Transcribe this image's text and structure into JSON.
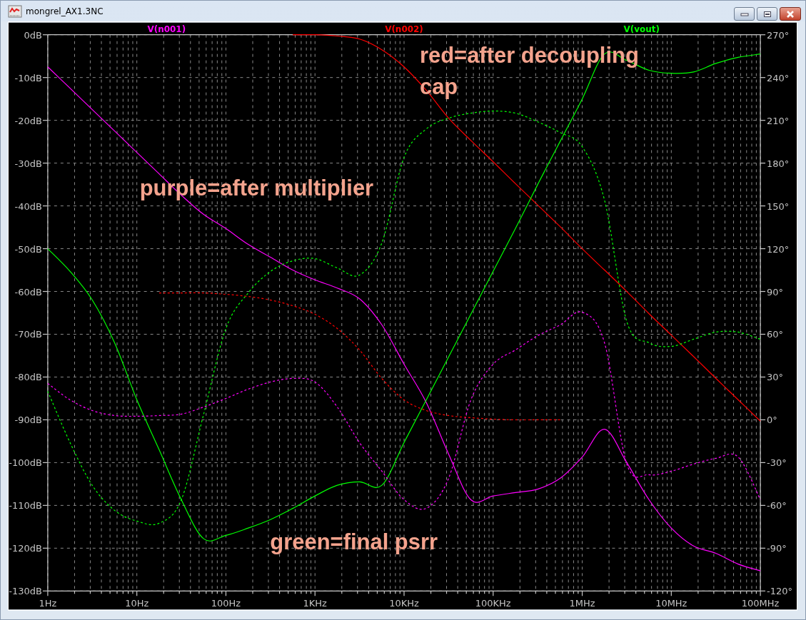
{
  "window": {
    "title": "mongrel_AX1.3NC"
  },
  "chart": {
    "chart_data": {
      "type": "line",
      "grid": true,
      "ylim": [
        -130,
        0
      ],
      "y2lim": [
        -120,
        270
      ],
      "yticks": [
        {
          "value": 0,
          "label": "0dB"
        },
        {
          "value": -10,
          "label": "-10dB"
        },
        {
          "value": -20,
          "label": "-20dB"
        },
        {
          "value": -30,
          "label": "-30dB"
        },
        {
          "value": -40,
          "label": "-40dB"
        },
        {
          "value": -50,
          "label": "-50dB"
        },
        {
          "value": -60,
          "label": "-60dB"
        },
        {
          "value": -70,
          "label": "-70dB"
        },
        {
          "value": -80,
          "label": "-80dB"
        },
        {
          "value": -90,
          "label": "-90dB"
        },
        {
          "value": -100,
          "label": "-100dB"
        },
        {
          "value": -110,
          "label": "-110dB"
        },
        {
          "value": -120,
          "label": "-120dB"
        },
        {
          "value": -130,
          "label": "-130dB"
        }
      ],
      "y2ticks": [
        {
          "value": 270,
          "label": "270°"
        },
        {
          "value": 240,
          "label": "240°"
        },
        {
          "value": 210,
          "label": "210°"
        },
        {
          "value": 180,
          "label": "180°"
        },
        {
          "value": 150,
          "label": "150°"
        },
        {
          "value": 120,
          "label": "120°"
        },
        {
          "value": 90,
          "label": "90°"
        },
        {
          "value": 60,
          "label": "60°"
        },
        {
          "value": 30,
          "label": "30°"
        },
        {
          "value": 0,
          "label": "0°"
        },
        {
          "value": -30,
          "label": "-30°"
        },
        {
          "value": -60,
          "label": "-60°"
        },
        {
          "value": -90,
          "label": "-90°"
        },
        {
          "value": -120,
          "label": "-120°"
        }
      ],
      "categories": [
        "1Hz",
        null,
        null,
        null,
        "10Hz",
        null,
        null,
        null,
        "100Hz",
        null,
        null,
        null,
        "1KHz",
        null,
        null,
        null,
        "10KHz",
        null,
        null,
        null,
        "100KHz",
        null,
        null,
        null,
        "1MHz",
        null,
        null,
        null,
        "10MHz",
        null,
        null,
        null,
        "100MHz"
      ],
      "series": [
        {
          "name": "V(n001)",
          "color": "#ff00ff",
          "values": [
            -7.5,
            -12.5,
            -17.5,
            -22.5,
            -27.5,
            -32.5,
            -37.5,
            -42,
            -45.3,
            -49,
            -52,
            -55,
            -57.3,
            -59.2,
            -61.7,
            -67.8,
            -77,
            -86,
            -98,
            -108.7,
            -107.8,
            -107,
            -106.2,
            -103.7,
            -98.7,
            -92.2,
            -100,
            -108.7,
            -115.3,
            -119.5,
            -121.2,
            -123.7,
            -125.3
          ]
        },
        {
          "name": "V(n002)",
          "color": "#ff0000",
          "values": [
            null,
            null,
            null,
            null,
            null,
            null,
            null,
            null,
            null,
            null,
            null,
            0,
            0,
            -0.3,
            -1,
            -3.5,
            -7.5,
            -13,
            -19.5,
            -24.7,
            -29.7,
            -34.8,
            -39.8,
            -44.8,
            -50,
            -55,
            -60,
            -65.2,
            -70.2,
            -75.2,
            -80.3,
            -85.3,
            -90.3
          ]
        },
        {
          "name": "V(vout)",
          "color": "#00ff00",
          "values": [
            -50,
            -55.3,
            -62,
            -72,
            -85.3,
            -97,
            -108.7,
            -117.8,
            -117,
            -115.3,
            -113.3,
            -110.7,
            -107.8,
            -105.3,
            -104.5,
            -105.3,
            -95.3,
            -85.3,
            -75.3,
            -65.3,
            -55.3,
            -45.3,
            -35,
            -25,
            -15,
            -4.5,
            -6,
            -8.3,
            -9,
            -8.7,
            -6.7,
            -5.3,
            -4.5
          ]
        },
        {
          "color": "#ff00ff",
          "axis": "y2",
          "line_style": "dashed",
          "values": [
            25.5,
            14,
            6.5,
            3,
            2.5,
            3,
            4,
            9,
            15,
            21.5,
            26.5,
            29,
            26.5,
            9,
            -16,
            -36,
            -56,
            -62,
            -41,
            14,
            39,
            49,
            59,
            66.5,
            75.5,
            54,
            -31,
            -38.5,
            -36,
            -31,
            -27,
            -26,
            -56
          ]
        },
        {
          "color": "#ff0000",
          "axis": "y2",
          "line_style": "dashed",
          "values": [
            null,
            null,
            null,
            null,
            null,
            89,
            89,
            89,
            88,
            86.5,
            84,
            80,
            74,
            64,
            49,
            29,
            14,
            6.5,
            3,
            1.5,
            0.5,
            0,
            0,
            0,
            null,
            null,
            null,
            null,
            null,
            null,
            null,
            null,
            null
          ]
        },
        {
          "color": "#00ff00",
          "axis": "y2",
          "line_style": "dashed",
          "values": [
            20,
            -16,
            -46,
            -63.5,
            -71,
            -72.5,
            -56,
            4,
            64,
            89,
            104,
            111.5,
            113,
            106.5,
            101.5,
            124,
            184,
            204,
            211.5,
            215,
            216.5,
            215,
            209,
            201.5,
            191.5,
            154,
            69,
            54,
            51.5,
            56.5,
            61.5,
            61.5,
            56.5
          ]
        }
      ],
      "annotations": [
        "red=after decoupling\ncap",
        "purple=after multiplier",
        "green=final psrr"
      ]
    }
  }
}
